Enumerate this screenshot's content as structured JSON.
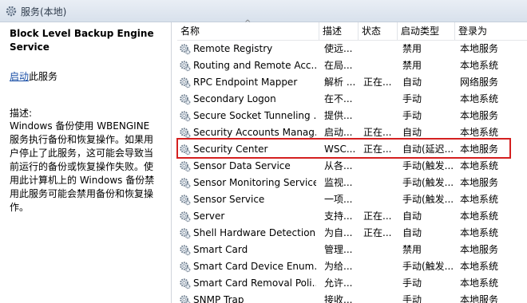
{
  "header": {
    "title": "服务(本地)",
    "icon": "gear-icon"
  },
  "left_panel": {
    "service_name": "Block Level Backup Engine Service",
    "start_link": "启动",
    "start_suffix": "此服务",
    "desc_label": "描述:",
    "description": "Windows 备份使用 WBENGINE 服务执行备份和恢复操作。如果用户停止了此服务，这可能会导致当前运行的备份或恢复操作失败。使用此计算机上的 Windows 备份禁用此服务可能会禁用备份和恢复操作。"
  },
  "table": {
    "sort_indicator": "^",
    "columns": [
      "名称",
      "描述",
      "状态",
      "启动类型",
      "登录为"
    ],
    "rows": [
      {
        "name": "Remote Registry",
        "desc": "使远...",
        "status": "",
        "startup": "禁用",
        "logon": "本地服务"
      },
      {
        "name": "Routing and Remote Acc...",
        "desc": "在局...",
        "status": "",
        "startup": "禁用",
        "logon": "本地系统"
      },
      {
        "name": "RPC Endpoint Mapper",
        "desc": "解析 ...",
        "status": "正在...",
        "startup": "自动",
        "logon": "网络服务"
      },
      {
        "name": "Secondary Logon",
        "desc": "在不...",
        "status": "",
        "startup": "手动",
        "logon": "本地系统"
      },
      {
        "name": "Secure Socket Tunneling ...",
        "desc": "提供...",
        "status": "",
        "startup": "手动",
        "logon": "本地服务"
      },
      {
        "name": "Security Accounts Manag...",
        "desc": "启动...",
        "status": "正在...",
        "startup": "自动",
        "logon": "本地系统"
      },
      {
        "name": "Security Center",
        "desc": "WSC...",
        "status": "正在...",
        "startup": "自动(延迟...",
        "logon": "本地服务"
      },
      {
        "name": "Sensor Data Service",
        "desc": "从各...",
        "status": "",
        "startup": "手动(触发...",
        "logon": "本地系统"
      },
      {
        "name": "Sensor Monitoring Service",
        "desc": "监视...",
        "status": "",
        "startup": "手动(触发...",
        "logon": "本地服务"
      },
      {
        "name": "Sensor Service",
        "desc": "一项...",
        "status": "",
        "startup": "手动(触发...",
        "logon": "本地系统"
      },
      {
        "name": "Server",
        "desc": "支持...",
        "status": "正在...",
        "startup": "自动",
        "logon": "本地系统"
      },
      {
        "name": "Shell Hardware Detection",
        "desc": "为自...",
        "status": "正在...",
        "startup": "自动",
        "logon": "本地系统"
      },
      {
        "name": "Smart Card",
        "desc": "管理...",
        "status": "",
        "startup": "禁用",
        "logon": "本地服务"
      },
      {
        "name": "Smart Card Device Enum...",
        "desc": "为给...",
        "status": "",
        "startup": "手动(触发...",
        "logon": "本地系统"
      },
      {
        "name": "Smart Card Removal Poli...",
        "desc": "允许...",
        "status": "",
        "startup": "手动",
        "logon": "本地系统"
      },
      {
        "name": "SNMP Trap",
        "desc": "接收...",
        "status": "",
        "startup": "手动",
        "logon": "本地服务"
      }
    ],
    "highlighted_row": "Security Center"
  },
  "colors": {
    "link": "#1a4fa6",
    "highlight_border": "#d42020"
  }
}
